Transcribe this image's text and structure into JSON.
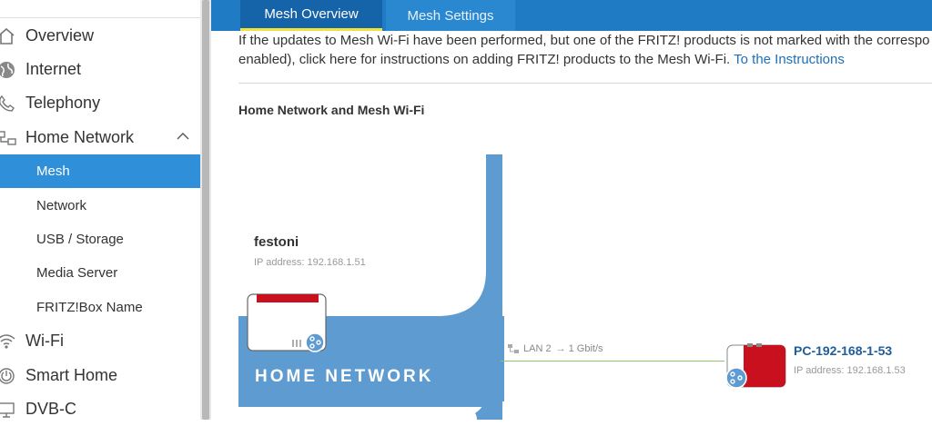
{
  "sidebar": {
    "items": [
      {
        "label": "Overview",
        "icon": "home-icon"
      },
      {
        "label": "Internet",
        "icon": "globe-icon"
      },
      {
        "label": "Telephony",
        "icon": "phone-icon"
      },
      {
        "label": "Home Network",
        "icon": "network-icon"
      },
      {
        "label": "Wi-Fi",
        "icon": "wifi-icon"
      },
      {
        "label": "Smart Home",
        "icon": "power-icon"
      },
      {
        "label": "DVB-C",
        "icon": "tv-icon"
      }
    ],
    "subitems": [
      {
        "label": "Mesh",
        "active": true
      },
      {
        "label": "Network",
        "active": false
      },
      {
        "label": "USB / Storage",
        "active": false
      },
      {
        "label": "Media Server",
        "active": false
      },
      {
        "label": "FRITZ!Box Name",
        "active": false
      }
    ]
  },
  "tabs": [
    {
      "label": "Mesh Overview",
      "active": true
    },
    {
      "label": "Mesh Settings",
      "active": false
    }
  ],
  "intro": {
    "line1": "If the updates to Mesh Wi-Fi have been performed, but one of the FRITZ! products is not marked with the correspo",
    "line2": "enabled), click here for instructions on adding FRITZ! products to the Mesh Wi-Fi.",
    "link": "To the Instructions"
  },
  "section_title": "Home Network and Mesh Wi-Fi",
  "home_network": {
    "panel_title": "HOME NETWORK",
    "device_name": "festoni",
    "device_ip": "IP address: 192.168.1.51"
  },
  "connection": {
    "label": "LAN 2",
    "speed": "→ 1 Gbit/s"
  },
  "client": {
    "name": "PC-192-168-1-53",
    "ip": "IP address: 192.168.1.53"
  },
  "colors": {
    "accent": "#1e7bc4",
    "active_tab": "#1563a8",
    "tab_underline": "#f2e33a",
    "panel_blue": "#5d9bd0",
    "router_red": "#c8101e",
    "line_green": "#8cc86a"
  }
}
